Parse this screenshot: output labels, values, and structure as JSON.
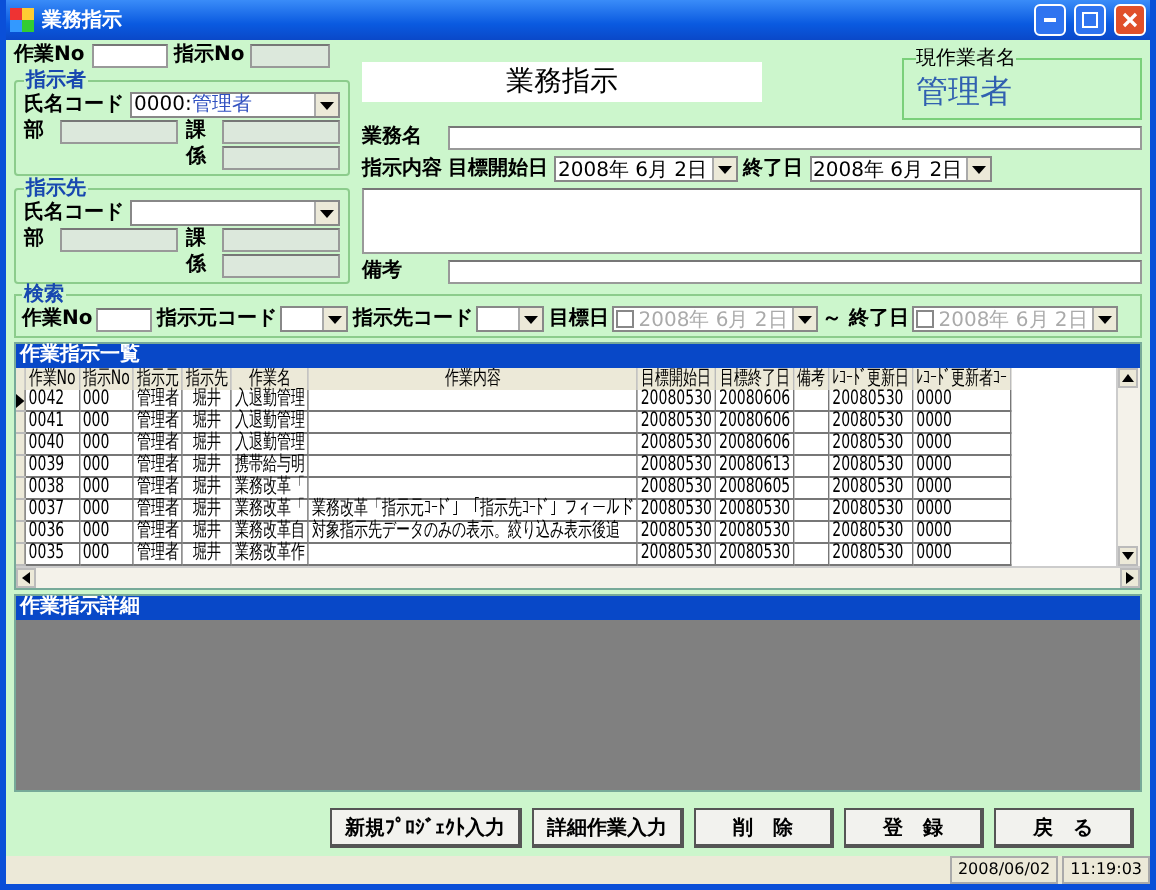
{
  "window": {
    "title": "業務指示"
  },
  "header": {
    "work_no_label": "作業No",
    "instruction_no_label": "指示No",
    "form_title": "業務指示",
    "current_worker_label": "現作業者名",
    "current_worker": "管理者"
  },
  "instructor": {
    "title": "指示者",
    "name_code_label": "氏名コード",
    "code": "0000:",
    "name": "管理者",
    "dept_label": "部",
    "section_label": "課",
    "unit_label": "係"
  },
  "recipient": {
    "title": "指示先",
    "name_code_label": "氏名コード",
    "dept_label": "部",
    "section_label": "課",
    "unit_label": "係"
  },
  "task": {
    "name_label": "業務名",
    "content_label": "指示内容",
    "start_label": "目標開始日",
    "start": "2008年  6月  2日",
    "end_label": "終了日",
    "end": "2008年  6月  2日",
    "remarks_label": "備考"
  },
  "search": {
    "title": "検索",
    "work_no_label": "作業No",
    "from_code_label": "指示元コード",
    "to_code_label": "指示先コード",
    "target_label": "目標日",
    "target_checked": false,
    "target_date": "2008年  6月  2日",
    "end_label": "～ 終了日",
    "end_checked": false,
    "end_date": "2008年  6月  2日"
  },
  "list": {
    "title": "作業指示一覧",
    "columns": [
      "作業No",
      "指示No",
      "指示元",
      "指示先",
      "作業名",
      "作業内容",
      "目標開始日",
      "目標終了日",
      "備考",
      "ﾚｺｰﾄﾞ更新日",
      "ﾚｺｰﾄﾞ更新者ｺｰ"
    ],
    "rows": [
      {
        "selected": true,
        "cells": [
          "0042",
          "000",
          "管理者",
          "堀井",
          "入退勤管理",
          "",
          "20080530",
          "20080606",
          "",
          "20080530",
          "0000"
        ]
      },
      {
        "selected": false,
        "cells": [
          "0041",
          "000",
          "管理者",
          "堀井",
          "入退勤管理",
          "",
          "20080530",
          "20080606",
          "",
          "20080530",
          "0000"
        ]
      },
      {
        "selected": false,
        "cells": [
          "0040",
          "000",
          "管理者",
          "堀井",
          "入退勤管理",
          "",
          "20080530",
          "20080606",
          "",
          "20080530",
          "0000"
        ]
      },
      {
        "selected": false,
        "cells": [
          "0039",
          "000",
          "管理者",
          "堀井",
          "携帯給与明",
          "",
          "20080530",
          "20080613",
          "",
          "20080530",
          "0000"
        ]
      },
      {
        "selected": false,
        "cells": [
          "0038",
          "000",
          "管理者",
          "堀井",
          "業務改革「",
          "",
          "20080530",
          "20080605",
          "",
          "20080530",
          "0000"
        ]
      },
      {
        "selected": false,
        "cells": [
          "0037",
          "000",
          "管理者",
          "堀井",
          "業務改革「",
          "業務改革「指示元ｺｰﾄﾞ」「指示先ｺｰﾄﾞ」フィールド",
          "20080530",
          "20080530",
          "",
          "20080530",
          "0000"
        ]
      },
      {
        "selected": false,
        "cells": [
          "0036",
          "000",
          "管理者",
          "堀井",
          "業務改革自",
          "対象指示先データのみの表示。絞り込み表示後追",
          "20080530",
          "20080530",
          "",
          "20080530",
          "0000"
        ]
      },
      {
        "selected": false,
        "cells": [
          "0035",
          "000",
          "管理者",
          "堀井",
          "業務改革作",
          "",
          "20080530",
          "20080530",
          "",
          "20080530",
          "0000"
        ]
      }
    ]
  },
  "detail": {
    "title": "作業指示詳細"
  },
  "buttons": [
    "新規ﾌﾟﾛｼﾞｪｸﾄ入力",
    "詳細作業入力",
    "削　除",
    "登　録",
    "戻　る"
  ],
  "status_bar": [
    "2008/06/02",
    "11:19:03"
  ]
}
